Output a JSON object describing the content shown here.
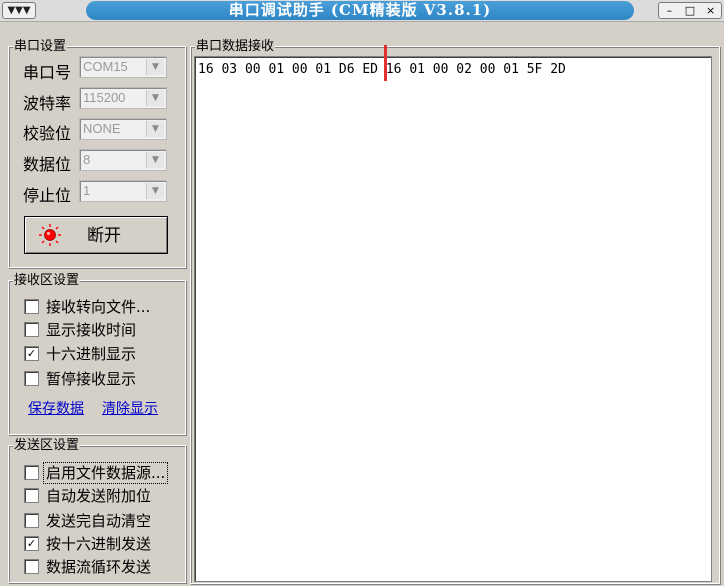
{
  "window": {
    "sysmenu_glyph": "▼▼▼",
    "title": "串口调试助手 (CM精装版 V3.8.1)",
    "controls": {
      "minimize": "–",
      "maximize": "□",
      "close": "×"
    }
  },
  "serial_settings": {
    "group_title": "串口设置",
    "port_label": "串口号",
    "port_value": "COM15",
    "baud_label": "波特率",
    "baud_value": "115200",
    "parity_label": "校验位",
    "parity_value": "NONE",
    "databits_label": "数据位",
    "databits_value": "8",
    "stopbits_label": "停止位",
    "stopbits_value": "1",
    "disconnect_label": "断开"
  },
  "receive_settings": {
    "group_title": "接收区设置",
    "options": [
      {
        "label": "接收转向文件...",
        "checked": false
      },
      {
        "label": "显示接收时间",
        "checked": false
      },
      {
        "label": "十六进制显示",
        "checked": true
      },
      {
        "label": "暂停接收显示",
        "checked": false
      }
    ],
    "save_link": "保存数据",
    "clear_link": "清除显示"
  },
  "send_settings": {
    "group_title": "发送区设置",
    "options": [
      {
        "label": "启用文件数据源...",
        "checked": false
      },
      {
        "label": "自动发送附加位",
        "checked": false
      },
      {
        "label": "发送完自动清空",
        "checked": false
      },
      {
        "label": "按十六进制发送",
        "checked": true
      },
      {
        "label": "数据流循环发送",
        "checked": false
      }
    ]
  },
  "receive_area": {
    "group_title": "串口数据接收",
    "segment1": "16 03 00 01 00 01 D6 ED",
    "segment2": "16 01 00 02 00 01 5F 2D"
  },
  "colors": {
    "title_bar_accent": "#2f86c6",
    "led_red": "#ff0000",
    "link_blue": "#0000cc",
    "cursor_red": "#e03030"
  },
  "checkmark_glyph": "✓"
}
